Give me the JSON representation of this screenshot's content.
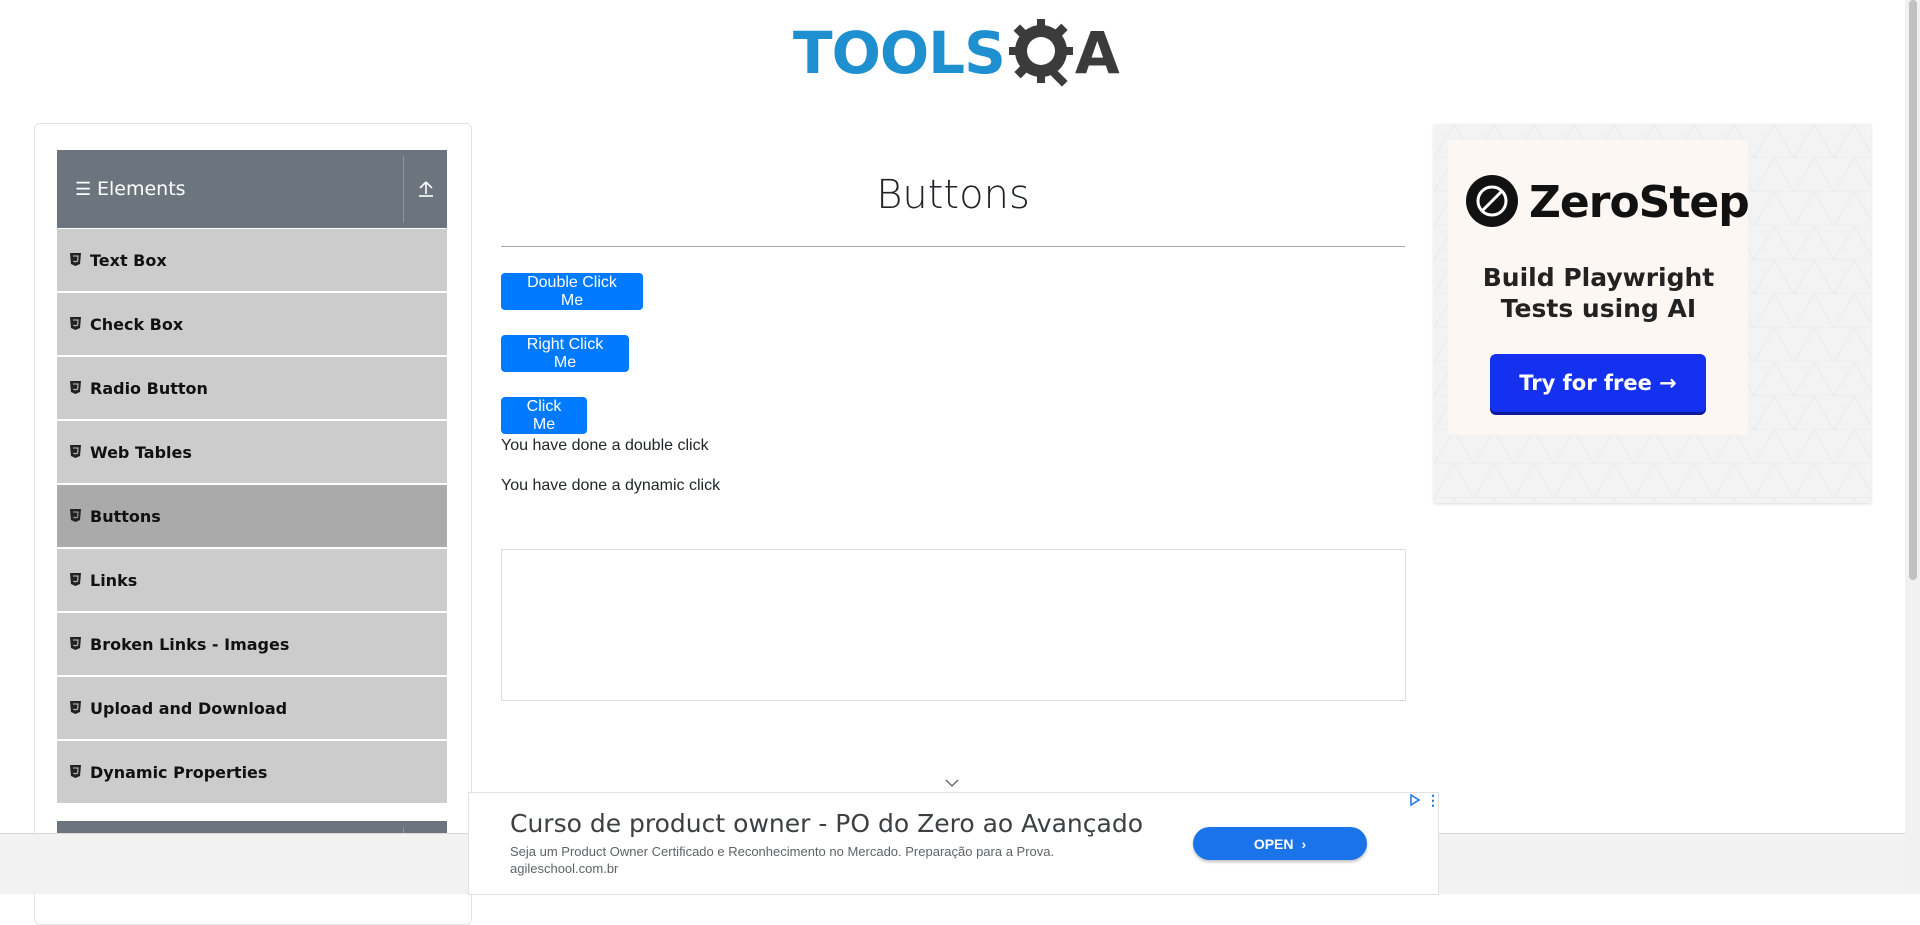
{
  "header": {
    "logo_text": "TOOLS",
    "logo_suffix": "A"
  },
  "sidebar": {
    "group_title": "Elements",
    "items": [
      {
        "label": "Text Box"
      },
      {
        "label": "Check Box"
      },
      {
        "label": "Radio Button"
      },
      {
        "label": "Web Tables"
      },
      {
        "label": "Buttons",
        "active": true
      },
      {
        "label": "Links"
      },
      {
        "label": "Broken Links - Images"
      },
      {
        "label": "Upload and Download"
      },
      {
        "label": "Dynamic Properties"
      }
    ]
  },
  "main": {
    "title": "Buttons",
    "double_click_button": "Double Click Me",
    "right_click_button": "Right Click Me",
    "click_button": "Click Me",
    "double_click_message": "You have done a double click",
    "dynamic_click_message": "You have done a dynamic click"
  },
  "ad_right": {
    "brand": "ZeroStep",
    "tagline_line1": "Build Playwright",
    "tagline_line2": "Tests using AI",
    "cta": "Try for free →"
  },
  "ad_bottom": {
    "title": "Curso de product owner - PO do Zero ao Avançado",
    "description": "Seja um Product Owner Certificado e Reconhecimento no Mercado. Preparação para a Prova.",
    "url": "agileschool.com.br",
    "cta": "OPEN"
  },
  "colors": {
    "primary_button": "#007bff",
    "sidebar_header": "#6c757d",
    "sidebar_item": "#cccccc",
    "sidebar_active": "#aaaaaa",
    "logo_blue": "#1e8fcf",
    "zerostep_button": "#1431f0",
    "ad_open_button": "#1a73e8"
  },
  "icons": [
    "bars-icon",
    "collapse-arrow-icon",
    "html5-icon",
    "zerostep-logo-icon",
    "chevron-down-icon",
    "ad-choices-icon"
  ]
}
